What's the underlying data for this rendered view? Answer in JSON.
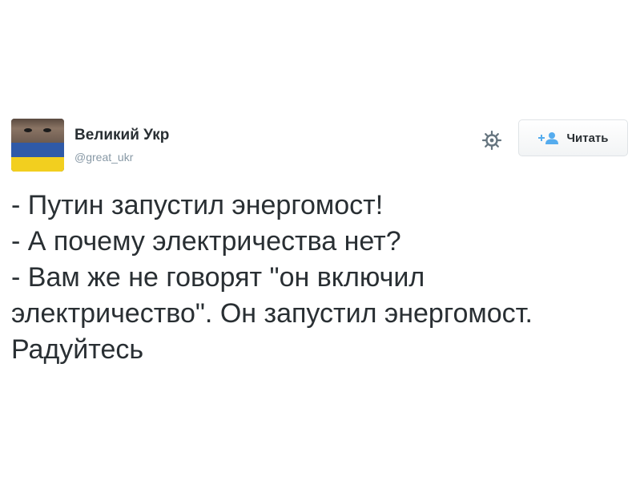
{
  "author": {
    "display_name": "Великий Укр",
    "handle": "@great_ukr",
    "avatar_icon": "avatar-ukraine-flag-face"
  },
  "actions": {
    "settings_icon": "gear-icon",
    "follow_icon": "follow-user-plus-icon",
    "follow_label": "Читать"
  },
  "tweet": {
    "lines": [
      "- Путин запустил энергомост!",
      "- А почему электричества нет?",
      "- Вам же не говорят \"он включил",
      "электричество\". Он запустил энергомост.",
      "Радуйтесь"
    ]
  },
  "colors": {
    "text": "#292f33",
    "muted": "#8899a6",
    "accent": "#55acee",
    "flag_blue": "#2f5aa8",
    "flag_yellow": "#f2cf1f"
  }
}
